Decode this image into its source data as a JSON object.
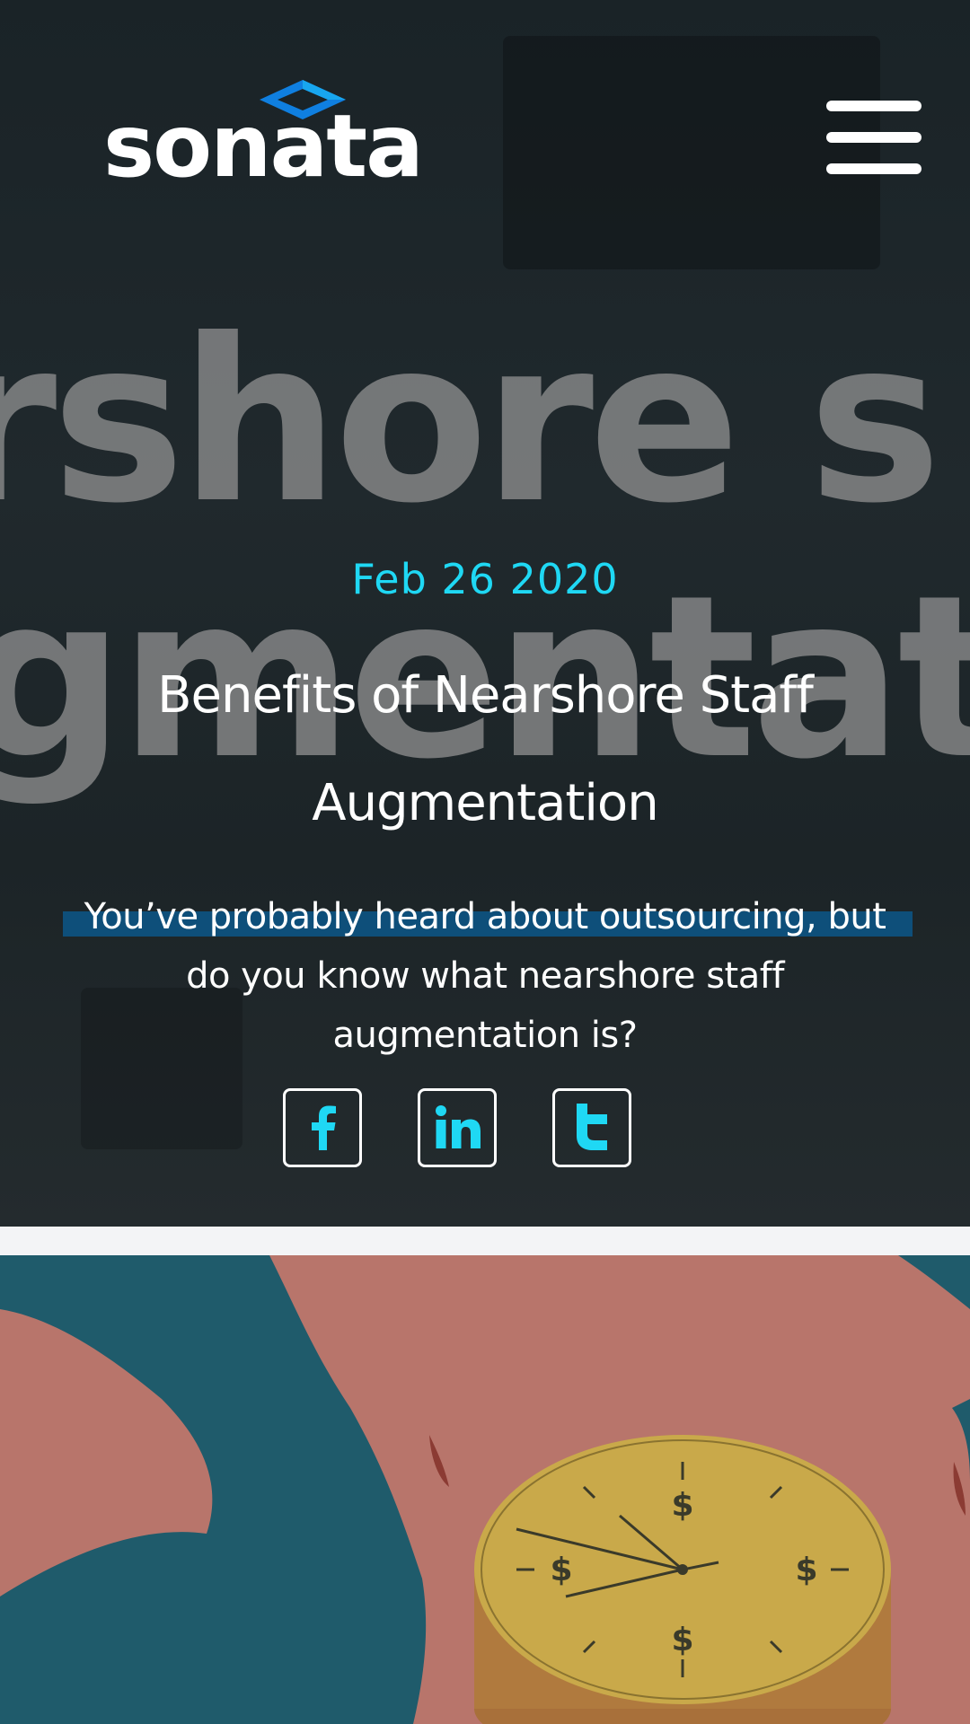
{
  "brand": {
    "logo_text": "sonata"
  },
  "header": {
    "menu_icon": "hamburger-menu-icon"
  },
  "hero": {
    "watermark_line1": "rshore s",
    "watermark_line2": "gmentat",
    "date": "Feb 26 2020",
    "title": "Benefits of Nearshore Staff Augmentation",
    "subtitle": "You’ve probably heard about outsourcing, but do you know what nearshore staff augmentation is?"
  },
  "social": [
    {
      "icon": "facebook-icon"
    },
    {
      "icon": "linkedin-icon"
    },
    {
      "icon": "twitter-icon"
    }
  ],
  "colors": {
    "accent_cyan": "#1fd8f4",
    "subtitle_highlight": "#0e4f7a",
    "illustration_teal": "#1f5b6b",
    "illustration_salmon": "#b8756b",
    "coin_gold": "#c9a94a"
  }
}
